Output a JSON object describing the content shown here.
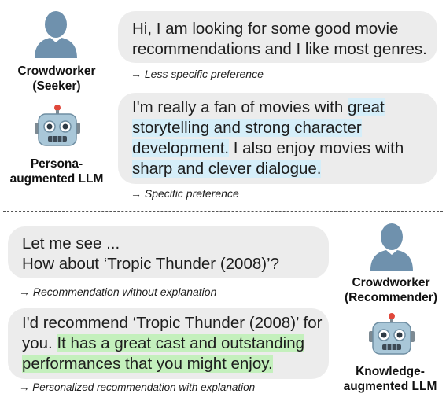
{
  "top": {
    "seeker_label": [
      "Crowdworker",
      "(Seeker)"
    ],
    "llm_label": [
      "Persona-",
      "augmented LLM"
    ],
    "bubble1": {
      "lines": [
        "Hi, I am looking for some good movie",
        "recommendations and I like most genres."
      ]
    },
    "note1": "→ Less specific preference",
    "bubble2": {
      "line1_plain": "I'm really a fan of movies with ",
      "line1_hl": "great",
      "line2_hl": "storytelling and strong character",
      "line3_hl": "development.",
      "line3_plain": " I also enjoy movies with",
      "line4_hl": "sharp and clever dialogue."
    },
    "note2": "→ Specific preference"
  },
  "bottom": {
    "recommender_label": [
      "Crowdworker",
      "(Recommender)"
    ],
    "llm_label": [
      "Knowledge-",
      "augmented LLM"
    ],
    "bubble3": {
      "lines": [
        "Let me see ...",
        "How about ‘Tropic Thunder (2008)’?"
      ]
    },
    "note3": "→ Recommendation without explanation",
    "bubble4": {
      "line1_plain": "I'd recommend ‘Tropic Thunder (2008)’ for",
      "line2_plain": "you. ",
      "line2_hl": "It has a great cast and outstanding",
      "line3_hl": "performances that you might enjoy."
    },
    "note4": "→ Personalized recommendation with explanation"
  },
  "colors": {
    "bubble": "#ececec",
    "highlight_blue": "#d5eef9",
    "highlight_green": "#c4f0bd",
    "person_icon": "#6f91ad",
    "robot_head": "#a9c7d8"
  },
  "icons": [
    "person-icon",
    "robot-icon"
  ]
}
